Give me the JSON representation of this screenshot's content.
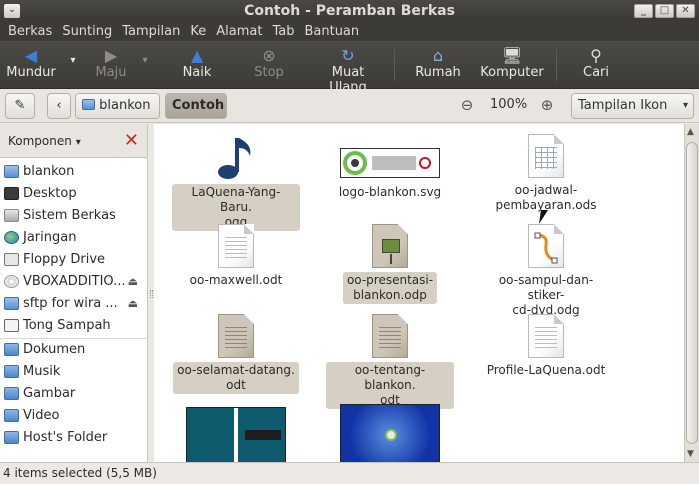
{
  "window": {
    "title": "Contoh - Peramban Berkas",
    "controls": [
      "_",
      "□",
      "✕"
    ]
  },
  "menu": [
    "Berkas",
    "Sunting",
    "Tampilan",
    "Ke",
    "Alamat",
    "Tab",
    "Bantuan"
  ],
  "toolbar": {
    "back": "Mundur",
    "forward": "Maju",
    "up": "Naik",
    "stop": "Stop",
    "reload": "Muat Ulang",
    "home": "Rumah",
    "computer": "Komputer",
    "search": "Cari"
  },
  "location": {
    "crumbs": [
      "blankon",
      "Contoh"
    ],
    "zoom": "100%",
    "view": "Tampilan Ikon"
  },
  "sidebar": {
    "title": "Komponen",
    "items": [
      {
        "label": "blankon",
        "icon": "home-folder-icon"
      },
      {
        "label": "Desktop",
        "icon": "desktop-icon"
      },
      {
        "label": "Sistem Berkas",
        "icon": "drive-icon"
      },
      {
        "label": "Jaringan",
        "icon": "network-globe-icon"
      },
      {
        "label": "Floppy Drive",
        "icon": "floppy-icon"
      },
      {
        "label": "VBOXADDITIO...",
        "icon": "cd-icon"
      },
      {
        "label": "sftp for wira ...",
        "icon": "network-folder-icon"
      },
      {
        "label": "Tong Sampah",
        "icon": "trash-icon"
      },
      {
        "label": "Dokumen",
        "icon": "folder-icon"
      },
      {
        "label": "Musik",
        "icon": "folder-icon"
      },
      {
        "label": "Gambar",
        "icon": "folder-icon"
      },
      {
        "label": "Video",
        "icon": "folder-icon"
      },
      {
        "label": "Host's Folder",
        "icon": "folder-icon"
      }
    ]
  },
  "files": [
    {
      "name": "LaQuena-Yang-Baru.\nogg",
      "type": "audio",
      "selected": true
    },
    {
      "name": "logo-blankon.svg",
      "type": "image-logo",
      "selected": false
    },
    {
      "name": "oo-jadwal-\npembayaran.ods",
      "type": "spreadsheet",
      "selected": false
    },
    {
      "name": "oo-maxwell.odt",
      "type": "document",
      "selected": false
    },
    {
      "name": "oo-presentasi-\nblankon.odp",
      "type": "presentation",
      "selected": true
    },
    {
      "name": "oo-sampul-dan-stiker-\ncd-dvd.odg",
      "type": "drawing",
      "selected": false
    },
    {
      "name": "oo-selamat-datang.\nodt",
      "type": "document-grey",
      "selected": true
    },
    {
      "name": "oo-tentang-blankon.\nodt",
      "type": "document-grey",
      "selected": true
    },
    {
      "name": "Profile-LaQuena.odt",
      "type": "document",
      "selected": false
    },
    {
      "name": "",
      "type": "image-teal"
    },
    {
      "name": "",
      "type": "image-desktop"
    }
  ],
  "status": "4 items selected (5,5 MB)"
}
